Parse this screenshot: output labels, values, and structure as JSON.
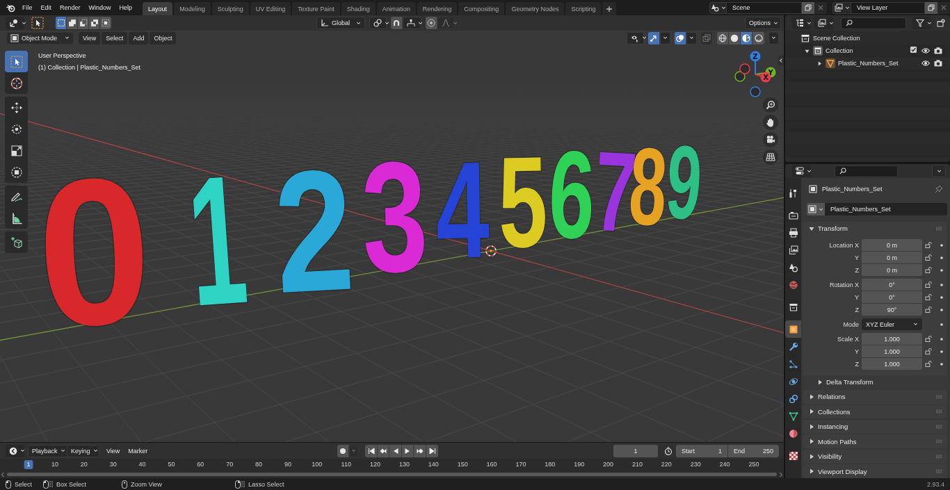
{
  "top_bar": {
    "menus": [
      "File",
      "Edit",
      "Render",
      "Window",
      "Help"
    ],
    "workspaces": [
      {
        "label": "Layout",
        "selected": true
      },
      {
        "label": "Modeling",
        "selected": false
      },
      {
        "label": "Sculpting",
        "selected": false
      },
      {
        "label": "UV Editing",
        "selected": false
      },
      {
        "label": "Texture Paint",
        "selected": false
      },
      {
        "label": "Shading",
        "selected": false
      },
      {
        "label": "Animation",
        "selected": false
      },
      {
        "label": "Rendering",
        "selected": false
      },
      {
        "label": "Compositing",
        "selected": false
      },
      {
        "label": "Geometry Nodes",
        "selected": false
      },
      {
        "label": "Scripting",
        "selected": false
      }
    ],
    "scene": "Scene",
    "view_layer": "View Layer"
  },
  "viewport": {
    "tool_header": {
      "select_modes": [
        {
          "kind": "set",
          "selected": true
        },
        {
          "kind": "extend",
          "selected": false
        },
        {
          "kind": "subtract",
          "selected": false
        },
        {
          "kind": "difference",
          "selected": false
        },
        {
          "kind": "intersect",
          "selected": false
        }
      ],
      "orientation": "Global",
      "snap": {
        "on": false
      },
      "proportional": {
        "on": false
      },
      "proportional_falloff": {
        "disabled": true
      },
      "options": "Options"
    },
    "header": {
      "mode": "Object Mode",
      "menus": [
        "View",
        "Select",
        "Add",
        "Object"
      ],
      "gizmos": {
        "on": true
      },
      "overlays": {
        "on": true
      },
      "xray": {
        "on": false
      },
      "shading": [
        {
          "kind": "wireframe",
          "selected": false
        },
        {
          "kind": "solid",
          "selected": false
        },
        {
          "kind": "material",
          "selected": true
        },
        {
          "kind": "rendered",
          "selected": false
        }
      ]
    },
    "info": [
      "User Perspective",
      "(1) Collection | Plastic_Numbers_Set"
    ],
    "tool_groups": [
      {
        "tools": [
          {
            "kind": "tweak",
            "selected": true
          },
          {
            "kind": "cursor",
            "selected": false
          }
        ]
      },
      {
        "tools": [
          {
            "kind": "move",
            "selected": false
          },
          {
            "kind": "rotate",
            "selected": false
          },
          {
            "kind": "scale",
            "selected": false
          },
          {
            "kind": "transform",
            "selected": false
          }
        ]
      },
      {
        "tools": [
          {
            "kind": "annotate",
            "selected": false
          },
          {
            "kind": "measure",
            "selected": false
          }
        ]
      },
      {
        "tools": [
          {
            "kind": "add_cube",
            "selected": false
          }
        ]
      }
    ],
    "axes": [
      {
        "label": "Z",
        "color": "#2f80e0"
      },
      {
        "label": "Y",
        "color": "#74b32a"
      },
      {
        "label": "X",
        "color": "#e83a50"
      }
    ],
    "objects": [
      {
        "digit": "0",
        "color": "#d8282b"
      },
      {
        "digit": "1",
        "color": "#2ed3c4"
      },
      {
        "digit": "2",
        "color": "#2aa9d8"
      },
      {
        "digit": "3",
        "color": "#d92ad6"
      },
      {
        "digit": "4",
        "color": "#2544d6"
      },
      {
        "digit": "5",
        "color": "#dccb22"
      },
      {
        "digit": "6",
        "color": "#2fd257"
      },
      {
        "digit": "7",
        "color": "#9a34dc"
      },
      {
        "digit": "8",
        "color": "#e5a223"
      },
      {
        "digit": "9",
        "color": "#2dbf86"
      }
    ]
  },
  "outliner": {
    "tree": [
      {
        "kind": "scene_collection",
        "label": "Scene Collection",
        "children": [
          {
            "kind": "collection",
            "label": "Collection",
            "expanded": true,
            "checked": true,
            "visible": true,
            "renderable": true,
            "children": [
              {
                "kind": "mesh_object",
                "label": "Plastic_Numbers_Set",
                "expanded": false,
                "visible": true,
                "renderable": true
              }
            ]
          }
        ]
      }
    ]
  },
  "properties": {
    "tab_groups": [
      {
        "tabs": [
          {
            "kind": "tool",
            "selected": false
          }
        ]
      },
      {
        "tabs": [
          {
            "kind": "render",
            "selected": false
          },
          {
            "kind": "output",
            "selected": false
          },
          {
            "kind": "view_layer",
            "selected": false
          },
          {
            "kind": "scene",
            "selected": false
          },
          {
            "kind": "world",
            "selected": false
          }
        ]
      },
      {
        "tabs": [
          {
            "kind": "collection",
            "selected": false
          }
        ]
      },
      {
        "tabs": [
          {
            "kind": "object",
            "selected": true
          },
          {
            "kind": "modifiers",
            "selected": false
          },
          {
            "kind": "particles",
            "selected": false
          },
          {
            "kind": "physics",
            "selected": false
          },
          {
            "kind": "constraints",
            "selected": false
          },
          {
            "kind": "data",
            "selected": false
          },
          {
            "kind": "material",
            "selected": false
          }
        ]
      },
      {
        "tabs": [
          {
            "kind": "texture",
            "selected": false
          }
        ]
      }
    ],
    "context_name": "Plastic_Numbers_Set",
    "object_name": "Plastic_Numbers_Set",
    "transform": {
      "title": "Transform",
      "expanded": true,
      "groups": [
        {
          "rows": [
            {
              "kind": "number",
              "label": "Location X",
              "value": "0 m",
              "locked": false
            },
            {
              "kind": "number",
              "label": "Y",
              "value": "0 m",
              "locked": false
            },
            {
              "kind": "number",
              "label": "Z",
              "value": "0 m",
              "locked": false
            }
          ]
        },
        {
          "rows": [
            {
              "kind": "number",
              "label": "Rotation X",
              "value": "0°",
              "locked": false
            },
            {
              "kind": "number",
              "label": "Y",
              "value": "0°",
              "locked": false
            },
            {
              "kind": "number",
              "label": "Z",
              "value": "90°",
              "locked": false
            }
          ]
        },
        {
          "rows": [
            {
              "kind": "dropdown",
              "label": "Mode",
              "value": "XYZ Euler"
            }
          ]
        },
        {
          "rows": [
            {
              "kind": "number",
              "label": "Scale X",
              "value": "1.000",
              "locked": false
            },
            {
              "kind": "number",
              "label": "Y",
              "value": "1.000",
              "locked": false
            },
            {
              "kind": "number",
              "label": "Z",
              "value": "1.000",
              "locked": false
            }
          ]
        }
      ],
      "subpanel": {
        "title": "Delta Transform",
        "expanded": false
      }
    },
    "panels": [
      {
        "title": "Relations",
        "expanded": false
      },
      {
        "title": "Collections",
        "expanded": false
      },
      {
        "title": "Instancing",
        "expanded": false
      },
      {
        "title": "Motion Paths",
        "expanded": false
      },
      {
        "title": "Visibility",
        "expanded": false
      },
      {
        "title": "Viewport Display",
        "expanded": false
      }
    ]
  },
  "timeline": {
    "menus": [
      {
        "kind": "dropdown",
        "label": "Playback"
      },
      {
        "kind": "dropdown",
        "label": "Keying"
      },
      {
        "kind": "menu",
        "label": "View"
      },
      {
        "kind": "menu",
        "label": "Marker"
      }
    ],
    "auto_keying": {
      "on": false
    },
    "controls": [
      {
        "kind": "jump_start"
      },
      {
        "kind": "prev_key"
      },
      {
        "kind": "play_reverse"
      },
      {
        "kind": "play"
      },
      {
        "kind": "next_key"
      },
      {
        "kind": "jump_end"
      }
    ],
    "current_frame": "1",
    "start": {
      "label": "Start",
      "value": "1"
    },
    "end": {
      "label": "End",
      "value": "250"
    },
    "ruler": [
      {
        "label": "1",
        "selected": true
      },
      {
        "label": "10",
        "selected": false
      },
      {
        "label": "20",
        "selected": false
      },
      {
        "label": "30",
        "selected": false
      },
      {
        "label": "40",
        "selected": false
      },
      {
        "label": "50",
        "selected": false
      },
      {
        "label": "60",
        "selected": false
      },
      {
        "label": "70",
        "selected": false
      },
      {
        "label": "80",
        "selected": false
      },
      {
        "label": "90",
        "selected": false
      },
      {
        "label": "100",
        "selected": false
      },
      {
        "label": "110",
        "selected": false
      },
      {
        "label": "120",
        "selected": false
      },
      {
        "label": "130",
        "selected": false
      },
      {
        "label": "140",
        "selected": false
      },
      {
        "label": "150",
        "selected": false
      },
      {
        "label": "160",
        "selected": false
      },
      {
        "label": "170",
        "selected": false
      },
      {
        "label": "180",
        "selected": false
      },
      {
        "label": "190",
        "selected": false
      },
      {
        "label": "200",
        "selected": false
      },
      {
        "label": "210",
        "selected": false
      },
      {
        "label": "220",
        "selected": false
      },
      {
        "label": "230",
        "selected": false
      },
      {
        "label": "240",
        "selected": false
      },
      {
        "label": "250",
        "selected": false
      }
    ]
  },
  "status_bar": {
    "hints": [
      {
        "kind": "left_click",
        "label": "Select"
      },
      {
        "kind": "left_drag",
        "label": "Box Select"
      },
      {
        "kind": "middle_click",
        "label": "Zoom View"
      },
      {
        "kind": "right_drag",
        "label": "Lasso Select"
      }
    ],
    "version": "2.93.4"
  }
}
